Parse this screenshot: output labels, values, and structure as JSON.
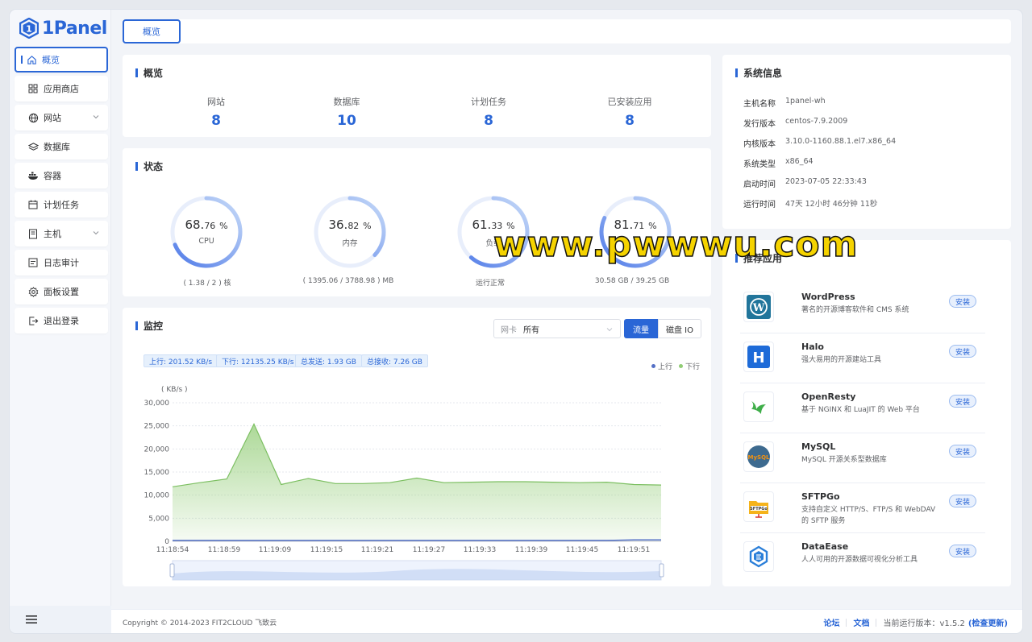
{
  "brand": {
    "name": "1Panel",
    "color": "#2a66d6"
  },
  "sidebar": {
    "items": [
      {
        "label": "概览",
        "icon": "home-icon",
        "active": true
      },
      {
        "label": "应用商店",
        "icon": "grid-icon"
      },
      {
        "label": "网站",
        "icon": "globe-icon",
        "expandable": true
      },
      {
        "label": "数据库",
        "icon": "layers-icon"
      },
      {
        "label": "容器",
        "icon": "docker-icon"
      },
      {
        "label": "计划任务",
        "icon": "calendar-icon"
      },
      {
        "label": "主机",
        "icon": "server-icon",
        "expandable": true
      },
      {
        "label": "日志审计",
        "icon": "log-icon"
      },
      {
        "label": "面板设置",
        "icon": "gear-icon"
      },
      {
        "label": "退出登录",
        "icon": "logout-icon"
      }
    ]
  },
  "topbar": {
    "tab_label": "概览"
  },
  "overview": {
    "title": "概览",
    "stats": [
      {
        "label": "网站",
        "value": "8"
      },
      {
        "label": "数据库",
        "value": "10"
      },
      {
        "label": "计划任务",
        "value": "8"
      },
      {
        "label": "已安装应用",
        "value": "8"
      }
    ]
  },
  "status": {
    "title": "状态",
    "gauges": [
      {
        "int": "68.",
        "dec": "76",
        "unit": "%",
        "label": "CPU",
        "footer": "( 1.38 / 2 ) 核",
        "percent": 68.76
      },
      {
        "int": "36.",
        "dec": "82",
        "unit": "%",
        "label": "内存",
        "footer": "( 1395.06 / 3788.98 ) MB",
        "percent": 36.82
      },
      {
        "int": "61.",
        "dec": "33",
        "unit": "%",
        "label": "负载",
        "footer": "运行正常",
        "percent": 61.33
      },
      {
        "int": "81.",
        "dec": "71",
        "unit": "%",
        "label": "",
        "footer": "30.58 GB / 39.25 GB",
        "percent": 81.71
      }
    ]
  },
  "monitor": {
    "title": "监控",
    "nic_label": "网卡",
    "nic_value": "所有",
    "btn_traffic": "流量",
    "btn_disk": "磁盘 IO",
    "tags": [
      "上行: 201.52 KB/s",
      "下行: 12135.25 KB/s",
      "总发送: 1.93 GB",
      "总接收: 7.26 GB"
    ],
    "legend": [
      {
        "name": "上行",
        "color": "#5470c6"
      },
      {
        "name": "下行",
        "color": "#91cc75"
      }
    ]
  },
  "chart_data": {
    "type": "area",
    "ylabel": "( KB/s )",
    "ylim": [
      0,
      30000
    ],
    "yticks": [
      "30,000",
      "25,000",
      "20,000",
      "15,000",
      "10,000",
      "5,000",
      "0"
    ],
    "xticks": [
      "11:18:54",
      "11:18:59",
      "11:19:09",
      "11:19:15",
      "11:19:21",
      "11:19:27",
      "11:19:33",
      "11:19:39",
      "11:19:45",
      "11:19:51"
    ],
    "series": [
      {
        "name": "下行",
        "color": "#91cc75",
        "values": [
          11800,
          12700,
          13500,
          25400,
          12300,
          13600,
          12500,
          12500,
          12700,
          13700,
          12700,
          12800,
          12900,
          12900,
          12800,
          12700,
          12800,
          12300,
          12200
        ]
      },
      {
        "name": "上行",
        "color": "#5470c6",
        "values": [
          200,
          200,
          200,
          200,
          200,
          200,
          200,
          200,
          200,
          200,
          200,
          200,
          200,
          200,
          200,
          200,
          200,
          300,
          300
        ]
      }
    ],
    "grid": true
  },
  "sysinfo": {
    "title": "系统信息",
    "rows": [
      {
        "k": "主机名称",
        "v": "1panel-wh"
      },
      {
        "k": "发行版本",
        "v": "centos-7.9.2009"
      },
      {
        "k": "内核版本",
        "v": "3.10.0-1160.88.1.el7.x86_64"
      },
      {
        "k": "系统类型",
        "v": "x86_64"
      },
      {
        "k": "启动时间",
        "v": "2023-07-05 22:33:43"
      },
      {
        "k": "运行时间",
        "v": "47天 12小时 46分钟 11秒"
      }
    ]
  },
  "apps": {
    "title": "推荐应用",
    "install_label": "安装",
    "items": [
      {
        "name": "WordPress",
        "desc": "著名的开源博客软件和 CMS 系统",
        "icon": "wordpress-icon"
      },
      {
        "name": "Halo",
        "desc": "强大易用的开源建站工具",
        "icon": "halo-icon"
      },
      {
        "name": "OpenResty",
        "desc": "基于 NGINX 和 LuaJIT 的 Web 平台",
        "icon": "openresty-icon"
      },
      {
        "name": "MySQL",
        "desc": "MySQL 开源关系型数据库",
        "icon": "mysql-icon"
      },
      {
        "name": "SFTPGo",
        "desc": "支持自定义 HTTP/S、FTP/S 和 WebDAV 的 SFTP 服务",
        "icon": "sftpgo-icon"
      },
      {
        "name": "DataEase",
        "desc": "人人可用的开源数据可视化分析工具",
        "icon": "dataease-icon"
      }
    ]
  },
  "footer": {
    "copyright": "Copyright © 2014-2023 FIT2CLOUD 飞致云",
    "forum": "论坛",
    "docs": "文档",
    "version_label": "当前运行版本：v1.5.2",
    "check_update": "(检查更新)"
  },
  "watermark": "www.pwwwu.com"
}
